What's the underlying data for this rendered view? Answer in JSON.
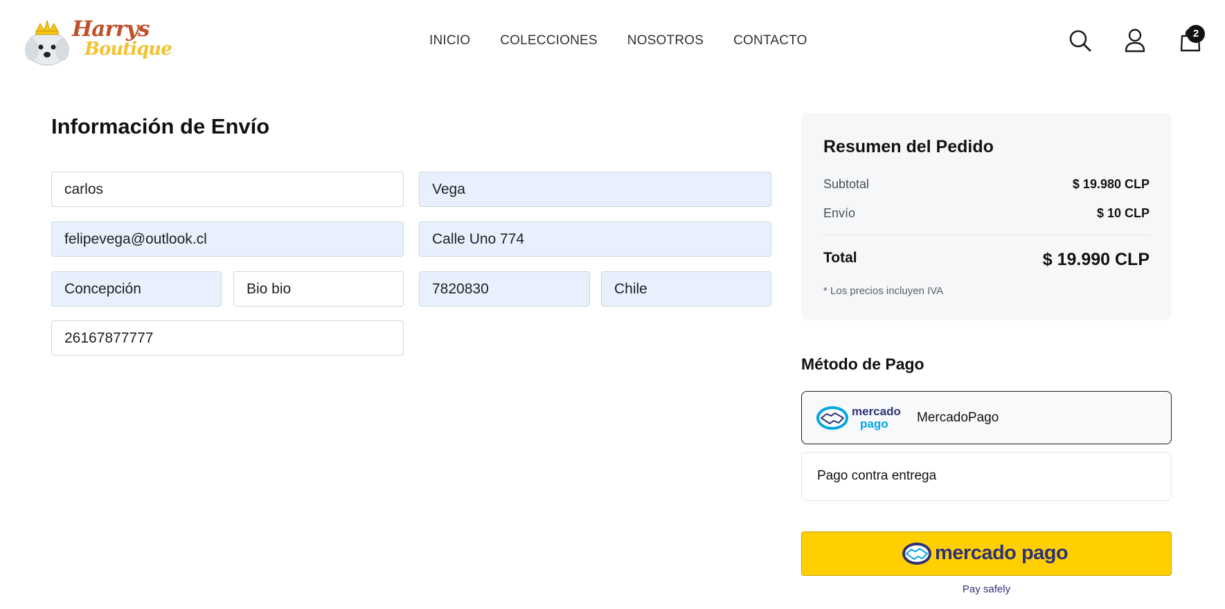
{
  "header": {
    "brand": {
      "line1": "Harrys",
      "line2": "Boutique"
    },
    "nav": [
      "INICIO",
      "COLECCIONES",
      "NOSOTROS",
      "CONTACTO"
    ],
    "cart_count": "2"
  },
  "shipping": {
    "title": "Información de Envío",
    "first_name": "carlos",
    "last_name": "Vega",
    "email": "felipevega@outlook.cl",
    "address": "Calle Uno 774",
    "city": "Concepción",
    "region": "Bio bio",
    "postal_code": "7820830",
    "country": "Chile",
    "phone": "26167877777"
  },
  "summary": {
    "title": "Resumen del Pedido",
    "subtotal_label": "Subtotal",
    "subtotal_value": "$ 19.980 CLP",
    "shipping_label": "Envío",
    "shipping_value": "$ 10 CLP",
    "total_label": "Total",
    "total_value": "$ 19.990 CLP",
    "note": "* Los precios incluyen IVA"
  },
  "payment": {
    "title": "Método de Pago",
    "options": [
      {
        "label": "MercadoPago",
        "logo_line1": "mercado",
        "logo_line2": "pago"
      },
      {
        "label": "Pago contra entrega"
      }
    ],
    "button_label": "mercado pago",
    "pay_safely": "Pay safely"
  },
  "colors": {
    "mp_yellow": "#ffcf00",
    "mp_navy": "#2d3277",
    "mp_blue": "#00a6e4",
    "autofill_bg": "#e8f0fe",
    "summary_bg": "#f6f7f9"
  }
}
